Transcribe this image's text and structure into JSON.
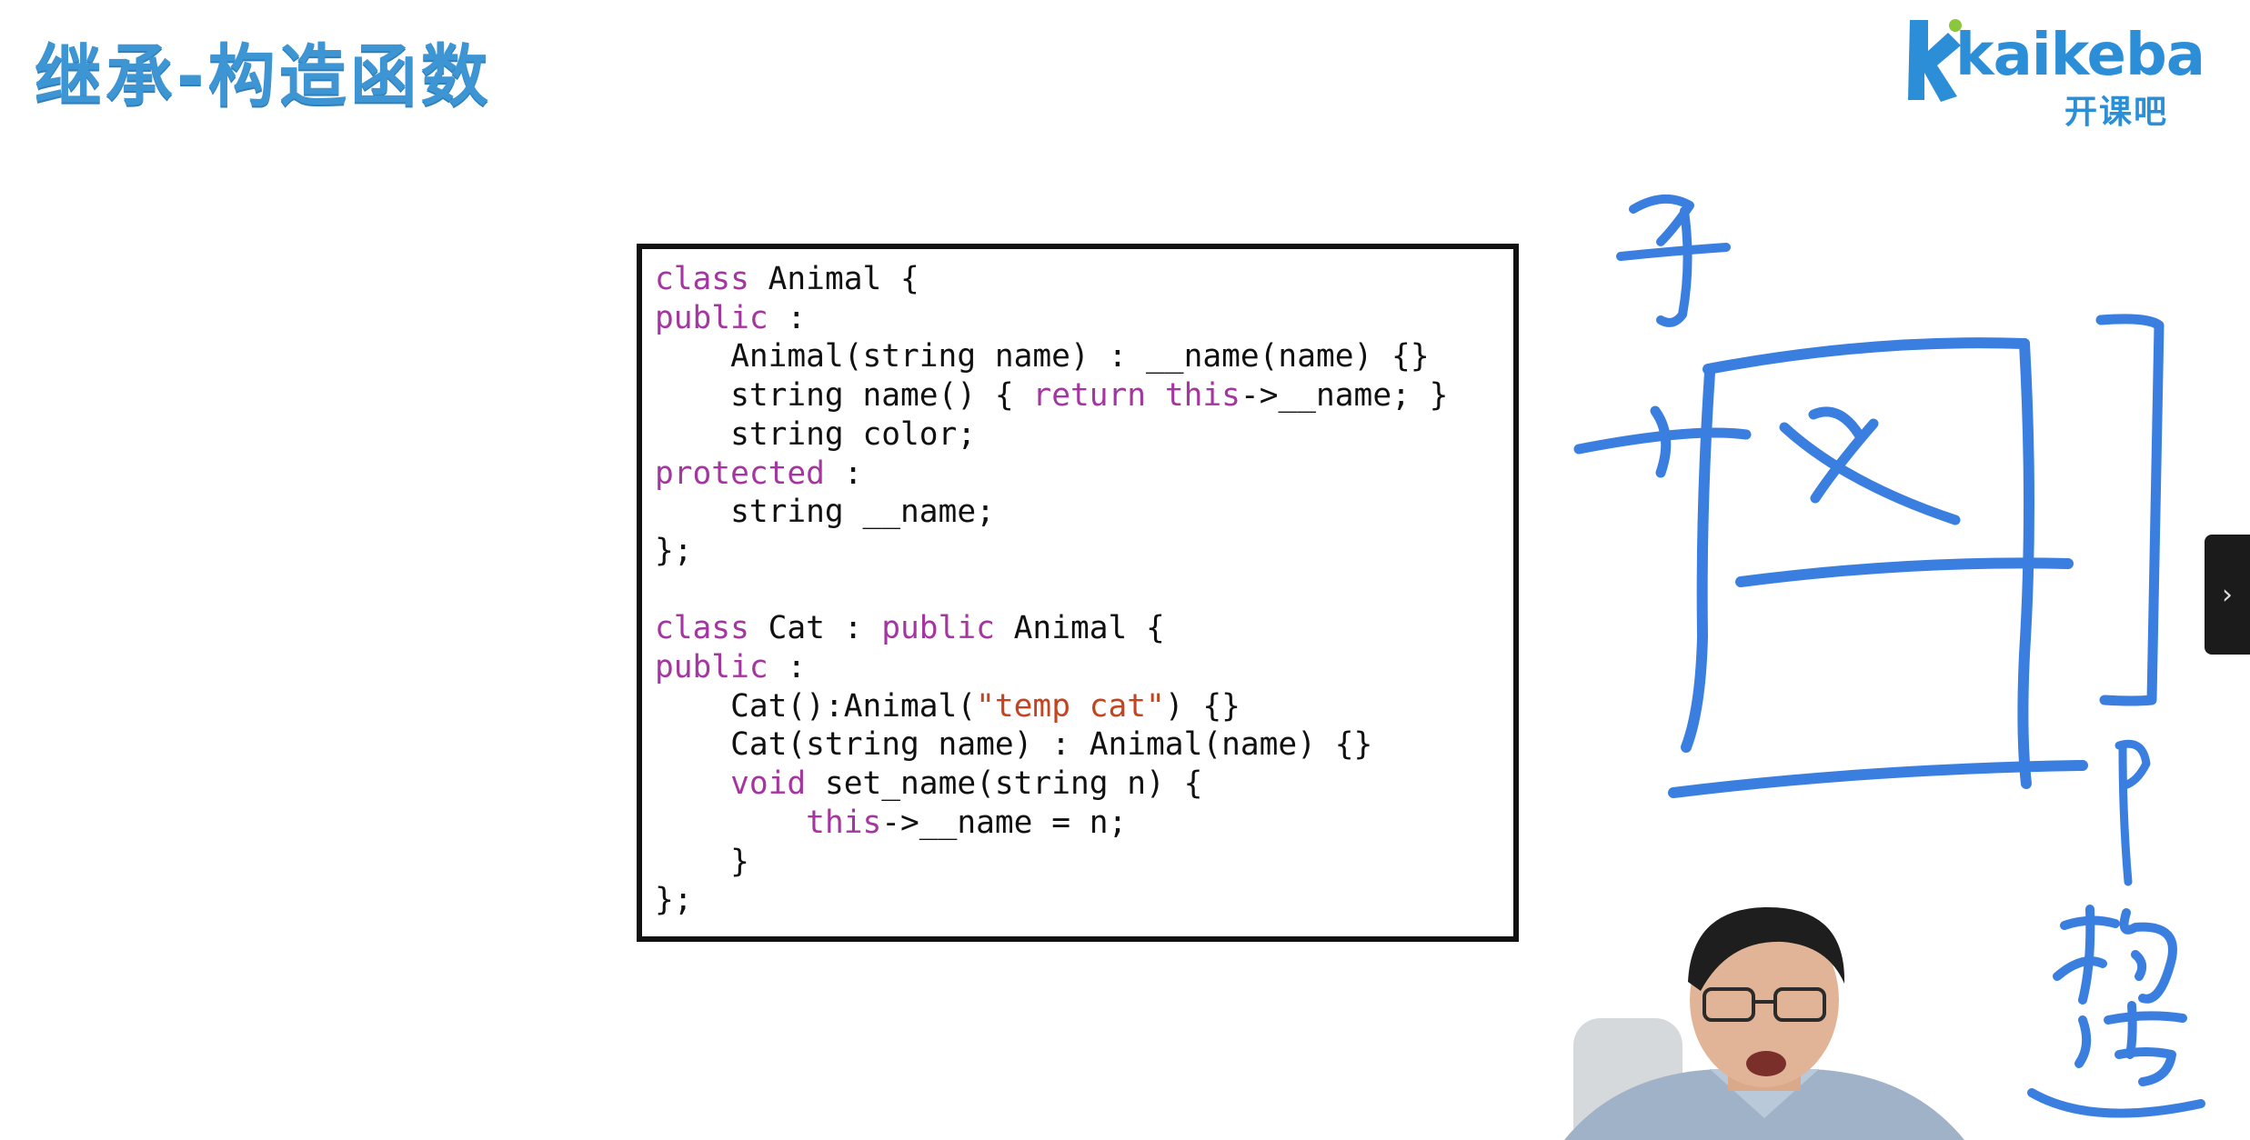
{
  "slide": {
    "title": "继承-构造函数"
  },
  "logo": {
    "word": "kaikeba",
    "chinese": "开课吧",
    "color": "#2c8ed6"
  },
  "code": {
    "lines": [
      [
        {
          "t": "class",
          "c": "kw"
        },
        {
          "t": " Animal {"
        }
      ],
      [
        {
          "t": "public",
          "c": "kw"
        },
        {
          "t": " :"
        }
      ],
      [
        {
          "t": "    Animal(string name) : __name(name) {}"
        }
      ],
      [
        {
          "t": "    string name() { "
        },
        {
          "t": "return",
          "c": "kw"
        },
        {
          "t": " "
        },
        {
          "t": "this",
          "c": "kw"
        },
        {
          "t": "->__name; }"
        }
      ],
      [
        {
          "t": "    string color;"
        }
      ],
      [
        {
          "t": "protected",
          "c": "kw"
        },
        {
          "t": " :"
        }
      ],
      [
        {
          "t": "    string __name;"
        }
      ],
      [
        {
          "t": "};"
        }
      ],
      [
        {
          "t": ""
        }
      ],
      [
        {
          "t": "class",
          "c": "kw"
        },
        {
          "t": " Cat : "
        },
        {
          "t": "public",
          "c": "kw"
        },
        {
          "t": " Animal {"
        }
      ],
      [
        {
          "t": "public",
          "c": "kw"
        },
        {
          "t": " :"
        }
      ],
      [
        {
          "t": "    Cat():Animal("
        },
        {
          "t": "\"temp cat\"",
          "c": "str"
        },
        {
          "t": ") {}"
        }
      ],
      [
        {
          "t": "    Cat(string name) : Animal(name) {}"
        }
      ],
      [
        {
          "t": "    "
        },
        {
          "t": "void",
          "c": "kw"
        },
        {
          "t": " set_name(string n) {"
        }
      ],
      [
        {
          "t": "        "
        },
        {
          "t": "this",
          "c": "kw"
        },
        {
          "t": "->__name = n;"
        }
      ],
      [
        {
          "t": "    }"
        }
      ],
      [
        {
          "t": "};"
        }
      ]
    ]
  },
  "annotations": {
    "handwritten_labels": [
      "子",
      "父",
      "构造"
    ],
    "ink_color": "#3a7fe0"
  },
  "controls": {
    "side_toggle_icon": "chevron-right-icon"
  }
}
